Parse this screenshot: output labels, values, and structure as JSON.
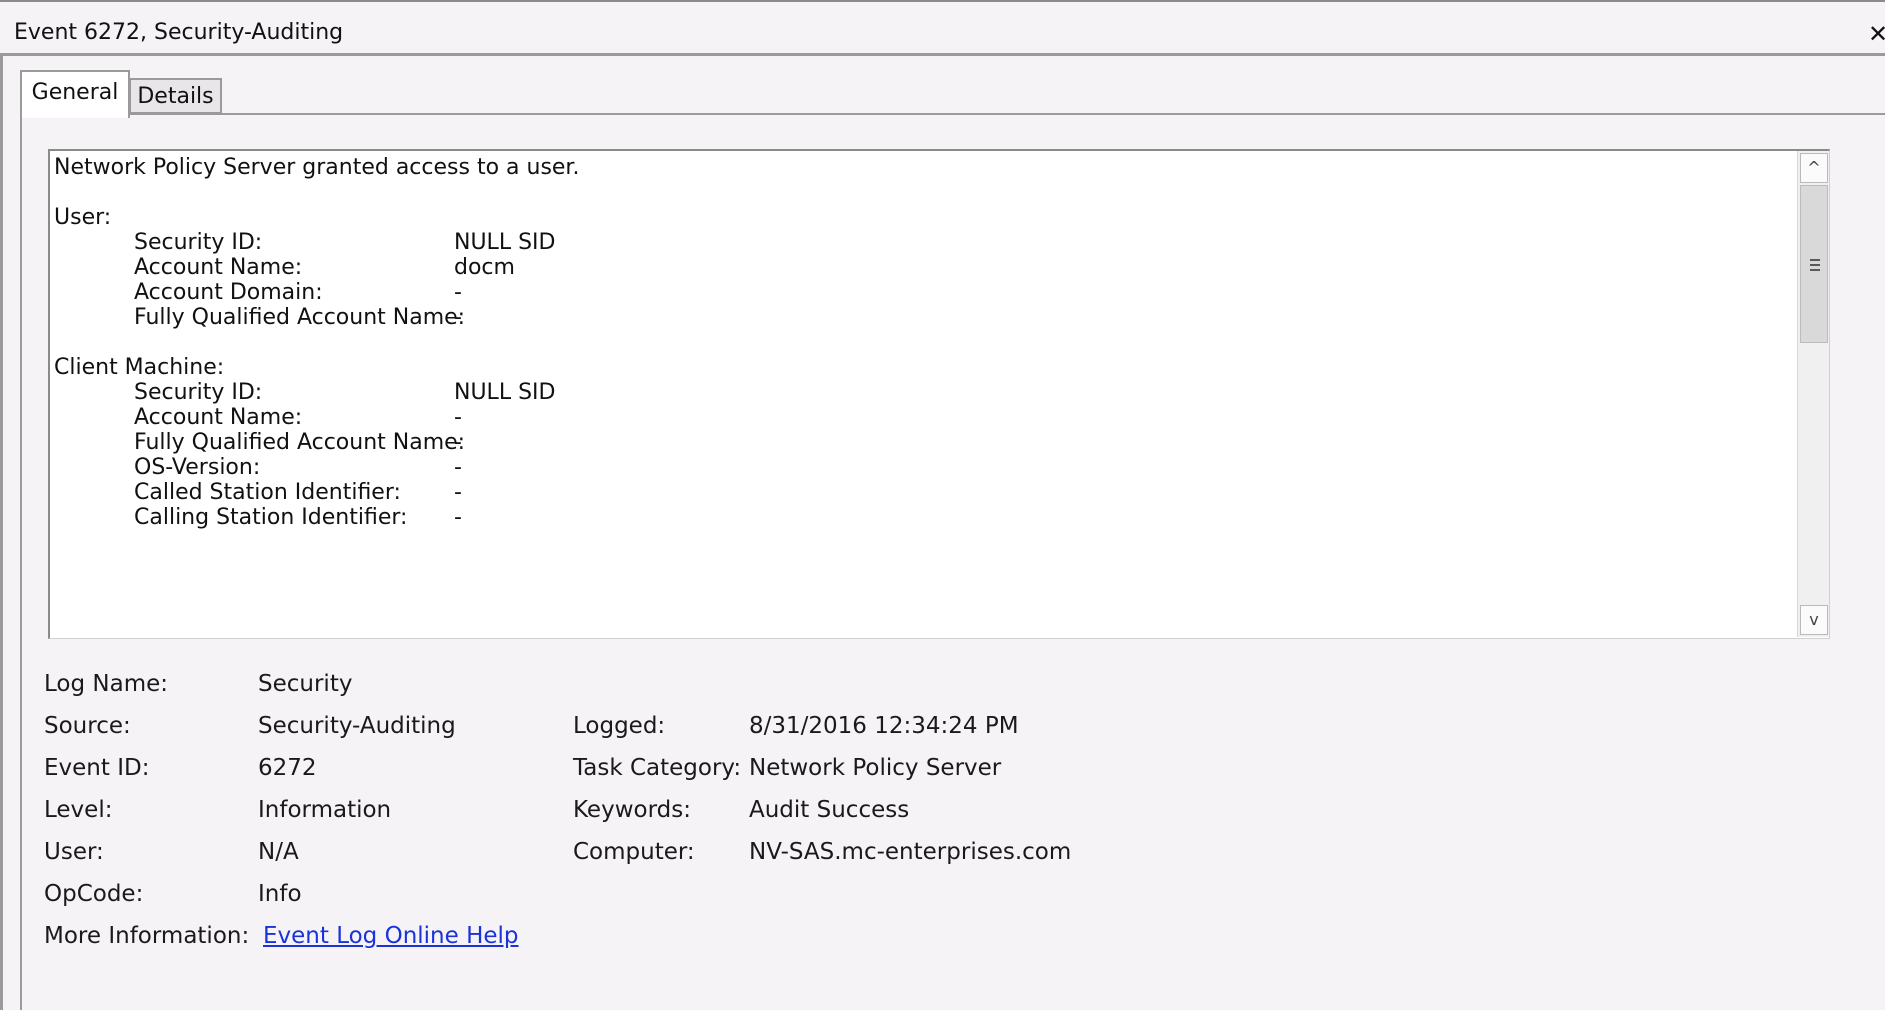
{
  "window": {
    "title": "Event 6272, Security-Auditing",
    "close_glyph": "✕"
  },
  "tabs": [
    {
      "label": "General",
      "selected": true
    },
    {
      "label": "Details",
      "selected": false
    }
  ],
  "description": {
    "summary": "Network Policy Server granted access to a user.",
    "user": {
      "heading": "User:",
      "fields": [
        {
          "label": "Security ID:",
          "value": "NULL SID"
        },
        {
          "label": "Account Name:",
          "value": "docm"
        },
        {
          "label": "Account Domain:",
          "value": "-"
        },
        {
          "label": "Fully Qualified Account Name:",
          "value": "-"
        }
      ]
    },
    "client_machine": {
      "heading": "Client Machine:",
      "fields": [
        {
          "label": "Security ID:",
          "value": "NULL SID"
        },
        {
          "label": "Account Name:",
          "value": "-"
        },
        {
          "label": "Fully Qualified Account Name:",
          "value": "-"
        },
        {
          "label": "OS-Version:",
          "value": "-"
        },
        {
          "label": "Called Station Identifier:",
          "value": "-"
        },
        {
          "label": "Calling Station Identifier:",
          "value": "-"
        }
      ]
    }
  },
  "properties": {
    "log_name": {
      "label": "Log Name:",
      "value": "Security"
    },
    "source": {
      "label": "Source:",
      "value": "Security-Auditing"
    },
    "event_id": {
      "label": "Event ID:",
      "value": "6272"
    },
    "level": {
      "label": "Level:",
      "value": "Information"
    },
    "user": {
      "label": "User:",
      "value": "N/A"
    },
    "opcode": {
      "label": "OpCode:",
      "value": "Info"
    },
    "more_info": {
      "label": "More Information:",
      "value": "Event Log Online Help"
    },
    "logged": {
      "label": "Logged:",
      "value": "8/31/2016 12:34:24 PM"
    },
    "task_category": {
      "label": "Task Category:",
      "value": "Network Policy Server"
    },
    "keywords": {
      "label": "Keywords:",
      "value": "Audit Success"
    },
    "computer": {
      "label": "Computer:",
      "value": "NV-SAS.mc-enterprises.com"
    }
  },
  "scrollbar": {
    "up_glyph": "^",
    "down_glyph": "v"
  }
}
